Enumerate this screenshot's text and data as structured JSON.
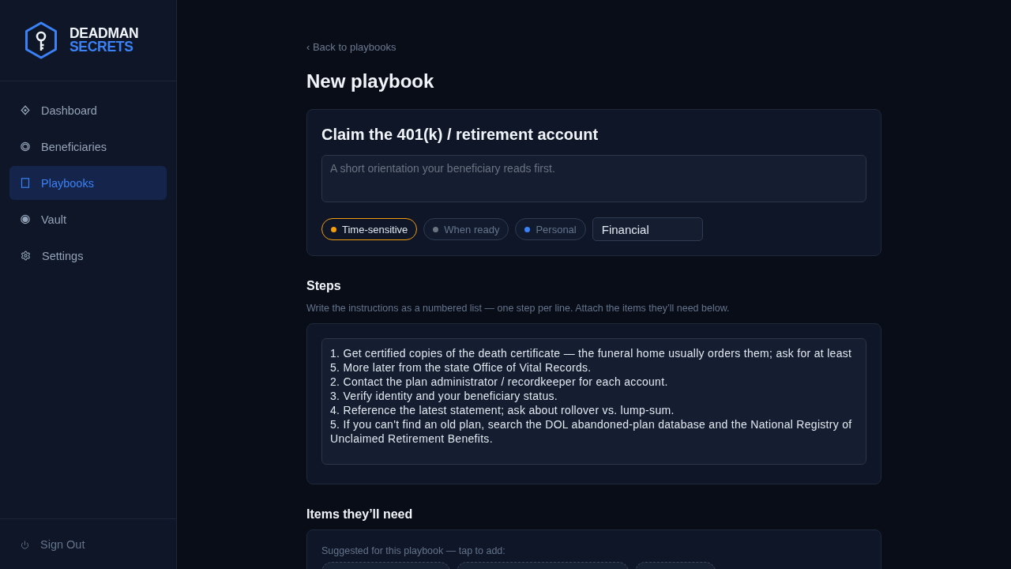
{
  "sidebar": {
    "logo": {
      "line_1": "DEADMAN",
      "line_2": "SECRETS"
    },
    "items": [
      {
        "label": "Dashboard",
        "selected": false
      },
      {
        "label": "Beneficiaries",
        "selected": false
      },
      {
        "label": "Playbooks",
        "selected": true
      },
      {
        "label": "Vault",
        "selected": false
      },
      {
        "label": "Settings",
        "selected": false
      }
    ],
    "footer": {
      "label": "Sign Out"
    }
  },
  "back_link": "‹ Back to playbooks",
  "page_title": "New playbook",
  "playbook": {
    "title": "Claim the 401(k) / retirement account",
    "summary": {
      "placeholder": "A short orientation your beneficiary reads first."
    },
    "tags": [
      {
        "label": "Time-sensitive",
        "selected": true,
        "color": "#f59e0b"
      },
      {
        "label": "When ready",
        "selected": false,
        "color": "#6b7280"
      },
      {
        "label": "Personal",
        "selected": false,
        "color": "#3b82f6"
      }
    ],
    "category": {
      "value": "Financial"
    }
  },
  "steps": {
    "heading": "Steps",
    "hint": "Write the instructions as a numbered list — one step per line. Attach the items they’ll need below.",
    "value": "1. Get certified copies of the death certificate — the funeral home usually orders them; ask for at least 5. More later from the state Office of Vital Records.\n2. Contact the plan administrator / recordkeeper for each account.\n3. Verify identity and your beneficiary status.\n4. Reference the latest statement; ask about rollover vs. lump-sum.\n5. If you can't find an old plan, search the DOL abandoned-plan database and the National Registry of Unclaimed Retirement Benefits."
  },
  "items": {
    "heading": "Items they’ll need",
    "hint": "Suggested for this playbook — tap to add:",
    "suggestions": [
      {
        "selected": false
      },
      {
        "selected": false
      },
      {
        "selected": false
      }
    ]
  }
}
